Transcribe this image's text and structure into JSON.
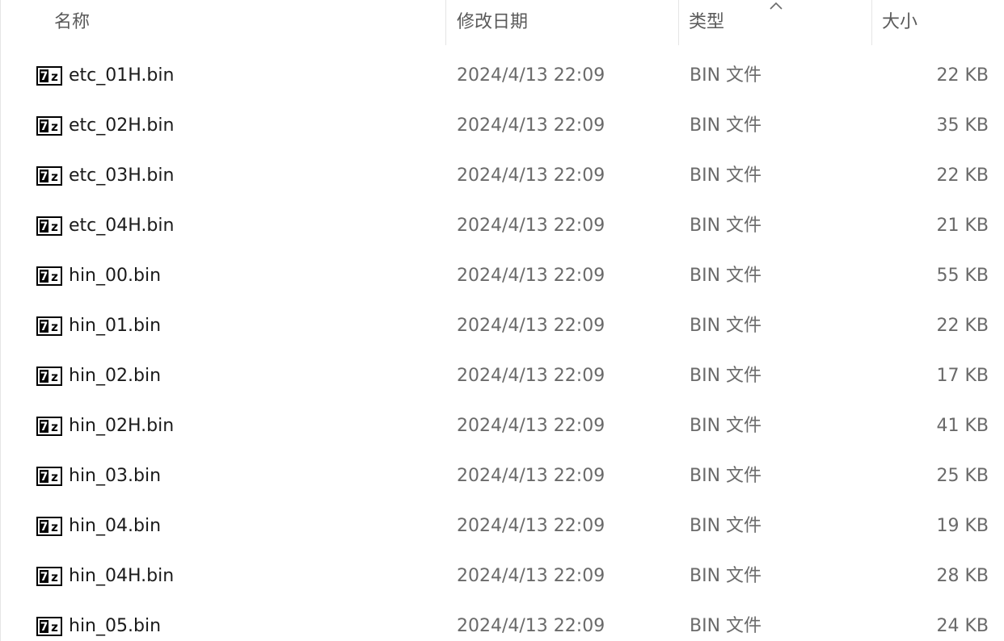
{
  "header": {
    "name": "名称",
    "date": "修改日期",
    "type": "类型",
    "size": "大小",
    "sorted_column": "type",
    "sort_indicator": "chevron-up-icon"
  },
  "file_icon": "7z-archive-icon",
  "files": [
    {
      "name": "etc_01H.bin",
      "date": "2024/4/13 22:09",
      "type": "BIN 文件",
      "size": "22 KB"
    },
    {
      "name": "etc_02H.bin",
      "date": "2024/4/13 22:09",
      "type": "BIN 文件",
      "size": "35 KB"
    },
    {
      "name": "etc_03H.bin",
      "date": "2024/4/13 22:09",
      "type": "BIN 文件",
      "size": "22 KB"
    },
    {
      "name": "etc_04H.bin",
      "date": "2024/4/13 22:09",
      "type": "BIN 文件",
      "size": "21 KB"
    },
    {
      "name": "hin_00.bin",
      "date": "2024/4/13 22:09",
      "type": "BIN 文件",
      "size": "55 KB"
    },
    {
      "name": "hin_01.bin",
      "date": "2024/4/13 22:09",
      "type": "BIN 文件",
      "size": "22 KB"
    },
    {
      "name": "hin_02.bin",
      "date": "2024/4/13 22:09",
      "type": "BIN 文件",
      "size": "17 KB"
    },
    {
      "name": "hin_02H.bin",
      "date": "2024/4/13 22:09",
      "type": "BIN 文件",
      "size": "41 KB"
    },
    {
      "name": "hin_03.bin",
      "date": "2024/4/13 22:09",
      "type": "BIN 文件",
      "size": "25 KB"
    },
    {
      "name": "hin_04.bin",
      "date": "2024/4/13 22:09",
      "type": "BIN 文件",
      "size": "19 KB"
    },
    {
      "name": "hin_04H.bin",
      "date": "2024/4/13 22:09",
      "type": "BIN 文件",
      "size": "28 KB"
    },
    {
      "name": "hin_05.bin",
      "date": "2024/4/13 22:09",
      "type": "BIN 文件",
      "size": "24 KB"
    }
  ]
}
